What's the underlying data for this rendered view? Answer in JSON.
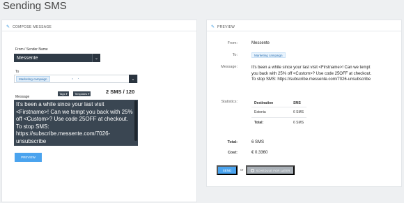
{
  "page": {
    "title": "Sending SMS"
  },
  "compose": {
    "header": "COMPOSE MESSAGE",
    "from_label": "From / Sender Name",
    "from_value": "Messente",
    "to_label": "To",
    "to_chip": "Marketing campaign",
    "message_label": "Message",
    "tags_btn": "Tags",
    "templates_btn": "Templates",
    "sms_count": "2 SMS / 120",
    "message_text": "It's been a while since your last visit <Firstname>! Can we tempt you back with 25% off <Custom>? Use code 25OFF at checkout.\nTo stop SMS: https://subscribe.messente.com/7026-unsubscribe",
    "preview_btn": "PREVIEW"
  },
  "preview": {
    "header": "PREVIEW",
    "from_label": "From:",
    "from_value": "Messente",
    "to_label": "To:",
    "to_chip": "Marketing campaign",
    "message_label": "Message:",
    "message_line1": "It's been a while since your last visit <Firstname>! Can we tempt",
    "message_line2": "you back with 25% off <Custom>? Use code 25OFF at checkout.",
    "message_line3": "To stop SMS: https://subscribe.messente.com/7026-unsubscribe",
    "statistics_label": "Statistics:",
    "stats_headers": {
      "destination": "Destination",
      "sms": "SMS"
    },
    "stats_rows": [
      {
        "destination": "Estonia",
        "sms": "6 SMS"
      },
      {
        "destination": "Total:",
        "sms": "6 SMS"
      }
    ],
    "total_label": "Total:",
    "total_value": "6 SMS",
    "cost_label": "Cost:",
    "cost_value": "€ 0.3360",
    "send_btn": "SEND",
    "or_text": "or",
    "schedule_btn": "SCHEDULE FOR LATER"
  },
  "icons": {
    "pencil": "pencil-icon",
    "chevron": "chevron-down-icon",
    "clock": "clock-icon"
  },
  "colors": {
    "accent": "#4aa3ee",
    "dark_input": "#3a4652",
    "select_bg": "#2f3b47"
  }
}
